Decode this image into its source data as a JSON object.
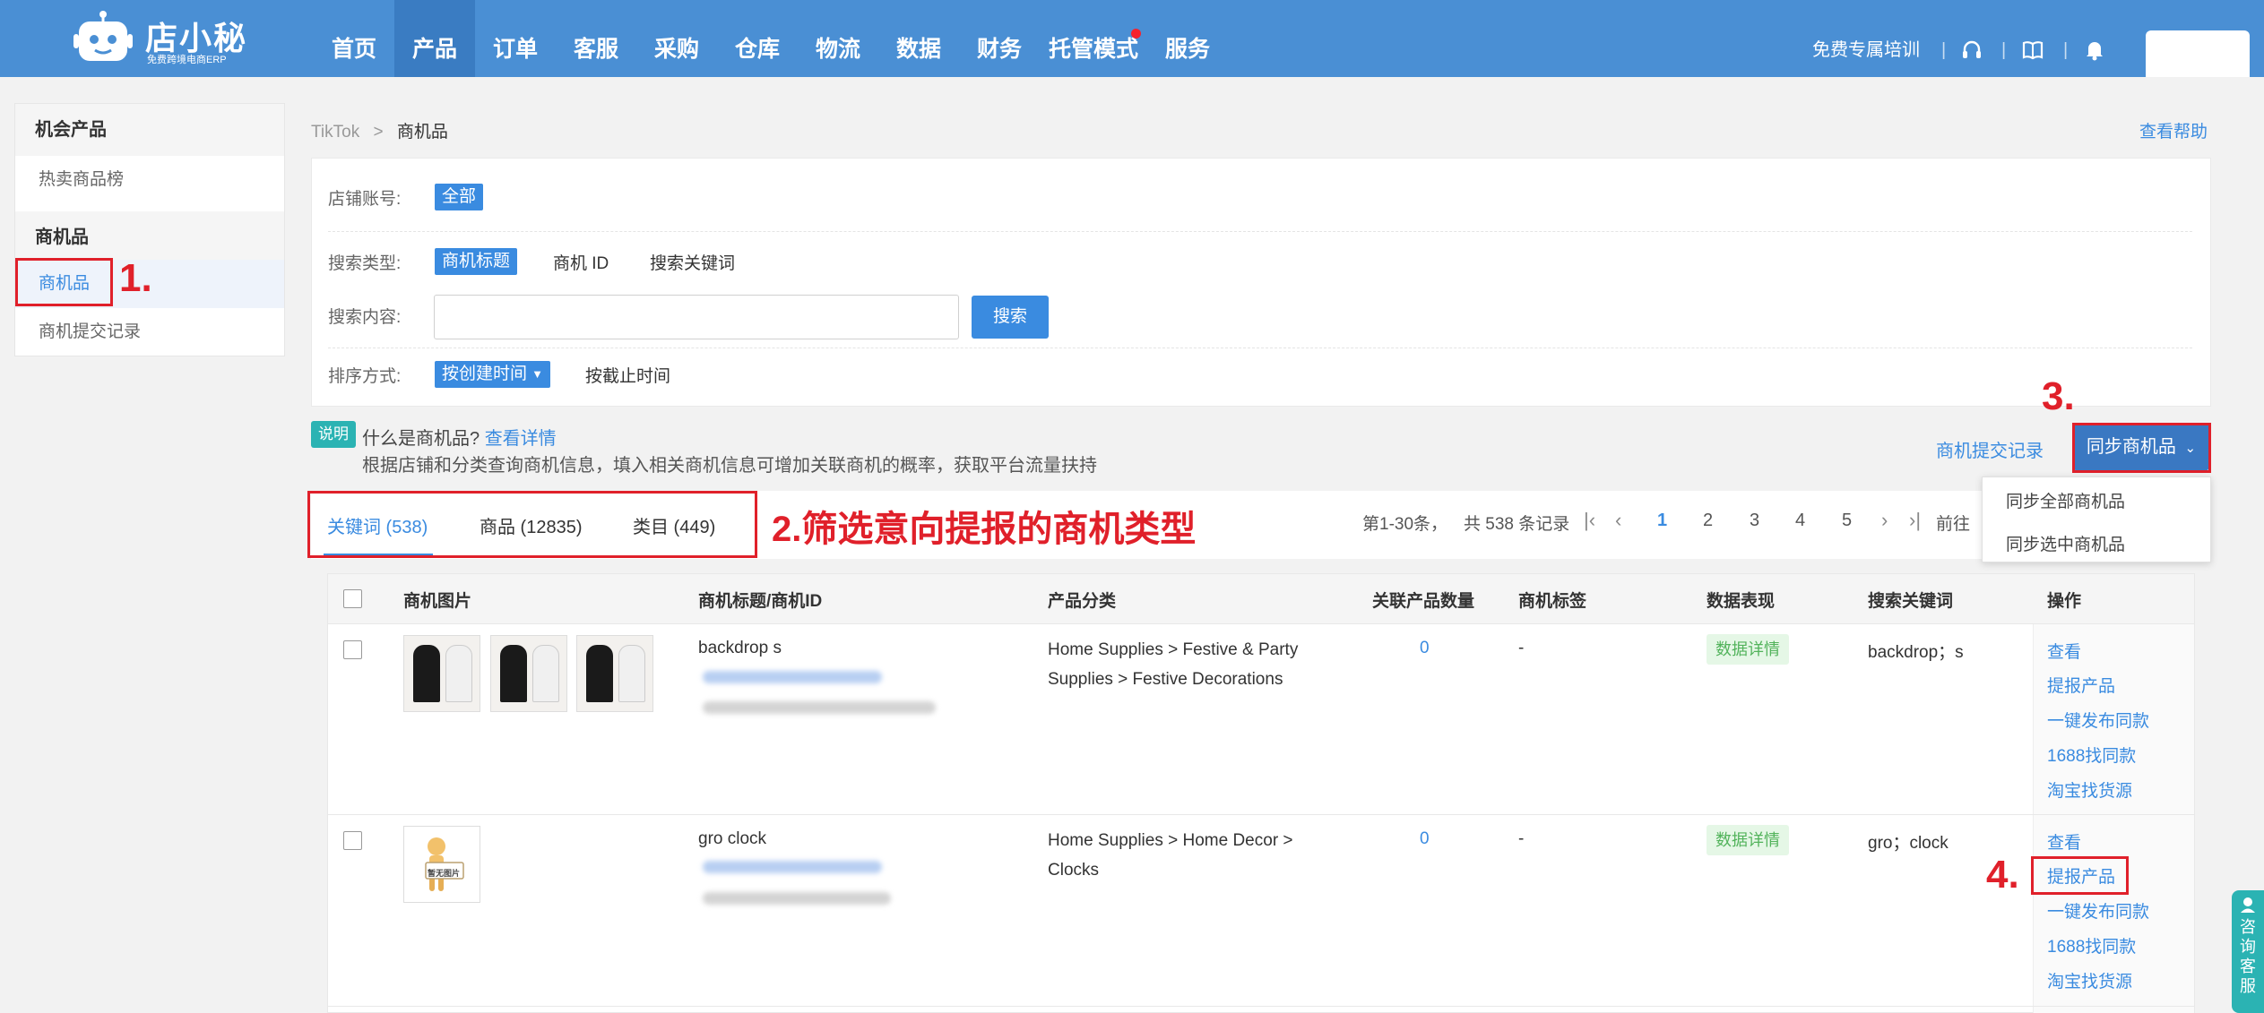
{
  "app": {
    "logo_text": "店小秘",
    "logo_sub": "免费跨境电商ERP",
    "brand_color": "#4a8fd4",
    "accent_color": "#3a8be0",
    "annotation_color": "#e0202a"
  },
  "nav": {
    "items": [
      {
        "label": "首页"
      },
      {
        "label": "产品"
      },
      {
        "label": "订单"
      },
      {
        "label": "客服"
      },
      {
        "label": "采购"
      },
      {
        "label": "仓库"
      },
      {
        "label": "物流"
      },
      {
        "label": "数据"
      },
      {
        "label": "财务"
      },
      {
        "label": "托管模式"
      },
      {
        "label": "服务"
      }
    ],
    "active": "产品",
    "training": "免费专属培训",
    "sep": "|",
    "icons": [
      "headset-icon",
      "book-icon",
      "bell-icon"
    ]
  },
  "sidebar": {
    "group1": "机会产品",
    "item1": "热卖商品榜",
    "group2": "商机品",
    "item2": "商机品",
    "item3": "商机提交记录"
  },
  "breadcrumb": {
    "root": "TikTok",
    "sep": ">",
    "current": "商机品"
  },
  "help": "查看帮助",
  "filters": {
    "shop_label": "店铺账号:",
    "shop_value": "全部",
    "type_label": "搜索类型:",
    "type_options": [
      "商机标题",
      "商机 ID",
      "搜索关键词"
    ],
    "content_label": "搜索内容:",
    "search_value": "",
    "search_button": "搜索",
    "sort_label": "排序方式:",
    "sort_active": "按创建时间",
    "sort_other": "按截止时间"
  },
  "note": {
    "badge": "说明",
    "question": "什么是商机品?",
    "link": "查看详情",
    "desc": "根据店铺和分类查询商机信息，填入相关商机信息可增加关联商机的概率，获取平台流量扶持"
  },
  "actions": {
    "submit_record": "商机提交记录",
    "sync_button": "同步商机品",
    "dropdown": [
      "同步全部商机品",
      "同步选中商机品"
    ]
  },
  "tabs": [
    {
      "label": "关键词 (538)"
    },
    {
      "label": "商品 (12835)"
    },
    {
      "label": "类目 (449)"
    }
  ],
  "pagination": {
    "range": "第1-30条，",
    "total": "共 538 条记录",
    "pages": [
      "1",
      "2",
      "3",
      "4",
      "5"
    ],
    "current": "1",
    "goto": "前往"
  },
  "table": {
    "headers": [
      "商机图片",
      "商机标题/商机ID",
      "产品分类",
      "关联产品数量",
      "商机标签",
      "数据表现",
      "搜索关键词",
      "操作"
    ],
    "rows": [
      {
        "title": "backdrop s",
        "category": "Home Supplies > Festive & Party Supplies > Festive Decorations",
        "count": "0",
        "tag": "-",
        "data_btn": "数据详情",
        "keywords": "backdrop；s",
        "ops": [
          "查看",
          "提报产品",
          "一键发布同款",
          "1688找同款",
          "淘宝找货源"
        ]
      },
      {
        "title": "gro clock",
        "category": "Home Supplies > Home Decor > Clocks",
        "count": "0",
        "tag": "-",
        "data_btn": "数据详情",
        "keywords": "gro；clock",
        "image_placeholder": "暂无图片",
        "ops": [
          "查看",
          "提报产品",
          "一键发布同款",
          "1688找同款",
          "淘宝找货源"
        ]
      }
    ]
  },
  "annotations": {
    "a1": "1.",
    "a2": "2.筛选意向提报的商机类型",
    "a3": "3.",
    "a4": "4."
  },
  "chat_widget": "咨询客服"
}
